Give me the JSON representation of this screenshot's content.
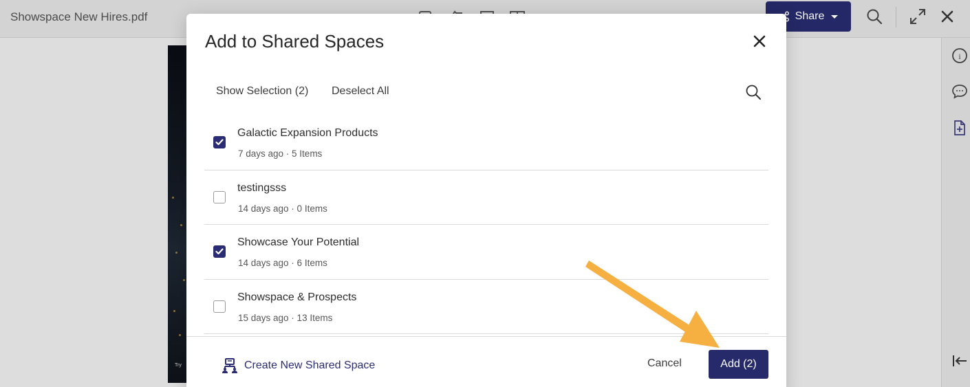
{
  "viewer": {
    "doc_title": "Showspace New Hires.pdf",
    "share_label": "Share",
    "toolbar_icons": [
      "note-icon",
      "thumbs-icon",
      "single-page-icon",
      "two-page-icon"
    ],
    "rail_icons": [
      "info-icon",
      "comment-icon",
      "document-link-icon",
      "collapse-panel-icon"
    ],
    "page_caption": "Try"
  },
  "modal": {
    "title": "Add to Shared Spaces",
    "show_selection": "Show Selection (2)",
    "deselect_all": "Deselect All",
    "spaces": [
      {
        "name": "Galactic Expansion Products",
        "meta": "7 days ago · 5 Items",
        "checked": true
      },
      {
        "name": "testingsss",
        "meta": "14 days ago · 0 Items",
        "checked": false
      },
      {
        "name": "Showcase Your Potential",
        "meta": "14 days ago · 6 Items",
        "checked": true
      },
      {
        "name": "Showspace & Prospects",
        "meta": "15 days ago · 13 Items",
        "checked": false
      }
    ],
    "create_label": "Create New Shared Space",
    "cancel_label": "Cancel",
    "add_label": "Add (2)"
  },
  "colors": {
    "accent": "#262a6b",
    "checkbox": "#2a2c74",
    "annotation_arrow": "#f5b041"
  }
}
